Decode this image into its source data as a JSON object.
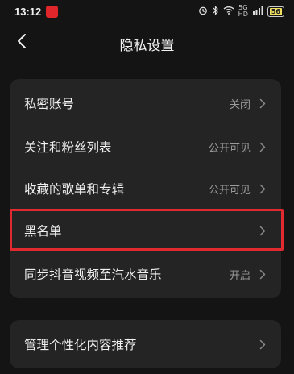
{
  "status": {
    "time": "13:12",
    "app_badge": "网易",
    "net_speed_top": "5G",
    "net_speed_bottom": "HD",
    "battery": "56"
  },
  "header": {
    "title": "隐私设置"
  },
  "settings": [
    {
      "label": "私密账号",
      "value": "关闭"
    },
    {
      "label": "关注和粉丝列表",
      "value": "公开可见"
    },
    {
      "label": "收藏的歌单和专辑",
      "value": "公开可见"
    },
    {
      "label": "黑名单",
      "value": ""
    },
    {
      "label": "同步抖音视频至汽水音乐",
      "value": "开启"
    }
  ],
  "second_card": {
    "label": "管理个性化内容推荐"
  },
  "colors": {
    "background": "#141414",
    "card": "#242424",
    "highlight": "#e02a2f"
  }
}
